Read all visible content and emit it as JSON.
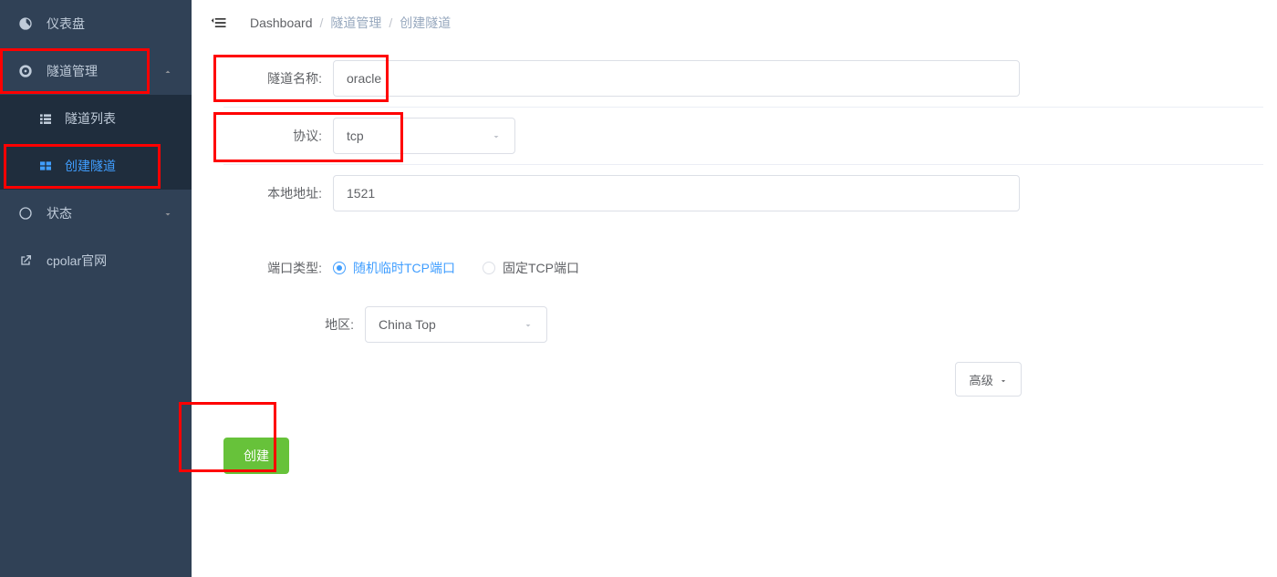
{
  "sidebar": {
    "items": [
      {
        "label": "仪表盘"
      },
      {
        "label": "隧道管理"
      },
      {
        "label": "隧道列表"
      },
      {
        "label": "创建隧道"
      },
      {
        "label": "状态"
      },
      {
        "label": "cpolar官网"
      }
    ]
  },
  "breadcrumb": {
    "c1": "Dashboard",
    "c2": "隧道管理",
    "c3": "创建隧道"
  },
  "form": {
    "tunnel_name_label": "隧道名称:",
    "tunnel_name_value": "oracle",
    "protocol_label": "协议:",
    "protocol_value": "tcp",
    "local_addr_label": "本地地址:",
    "local_addr_value": "1521",
    "port_type_label": "端口类型:",
    "port_type_options": {
      "random": "随机临时TCP端口",
      "fixed": "固定TCP端口"
    },
    "region_label": "地区:",
    "region_value": "China Top"
  },
  "buttons": {
    "advanced": "高级",
    "create": "创建"
  }
}
